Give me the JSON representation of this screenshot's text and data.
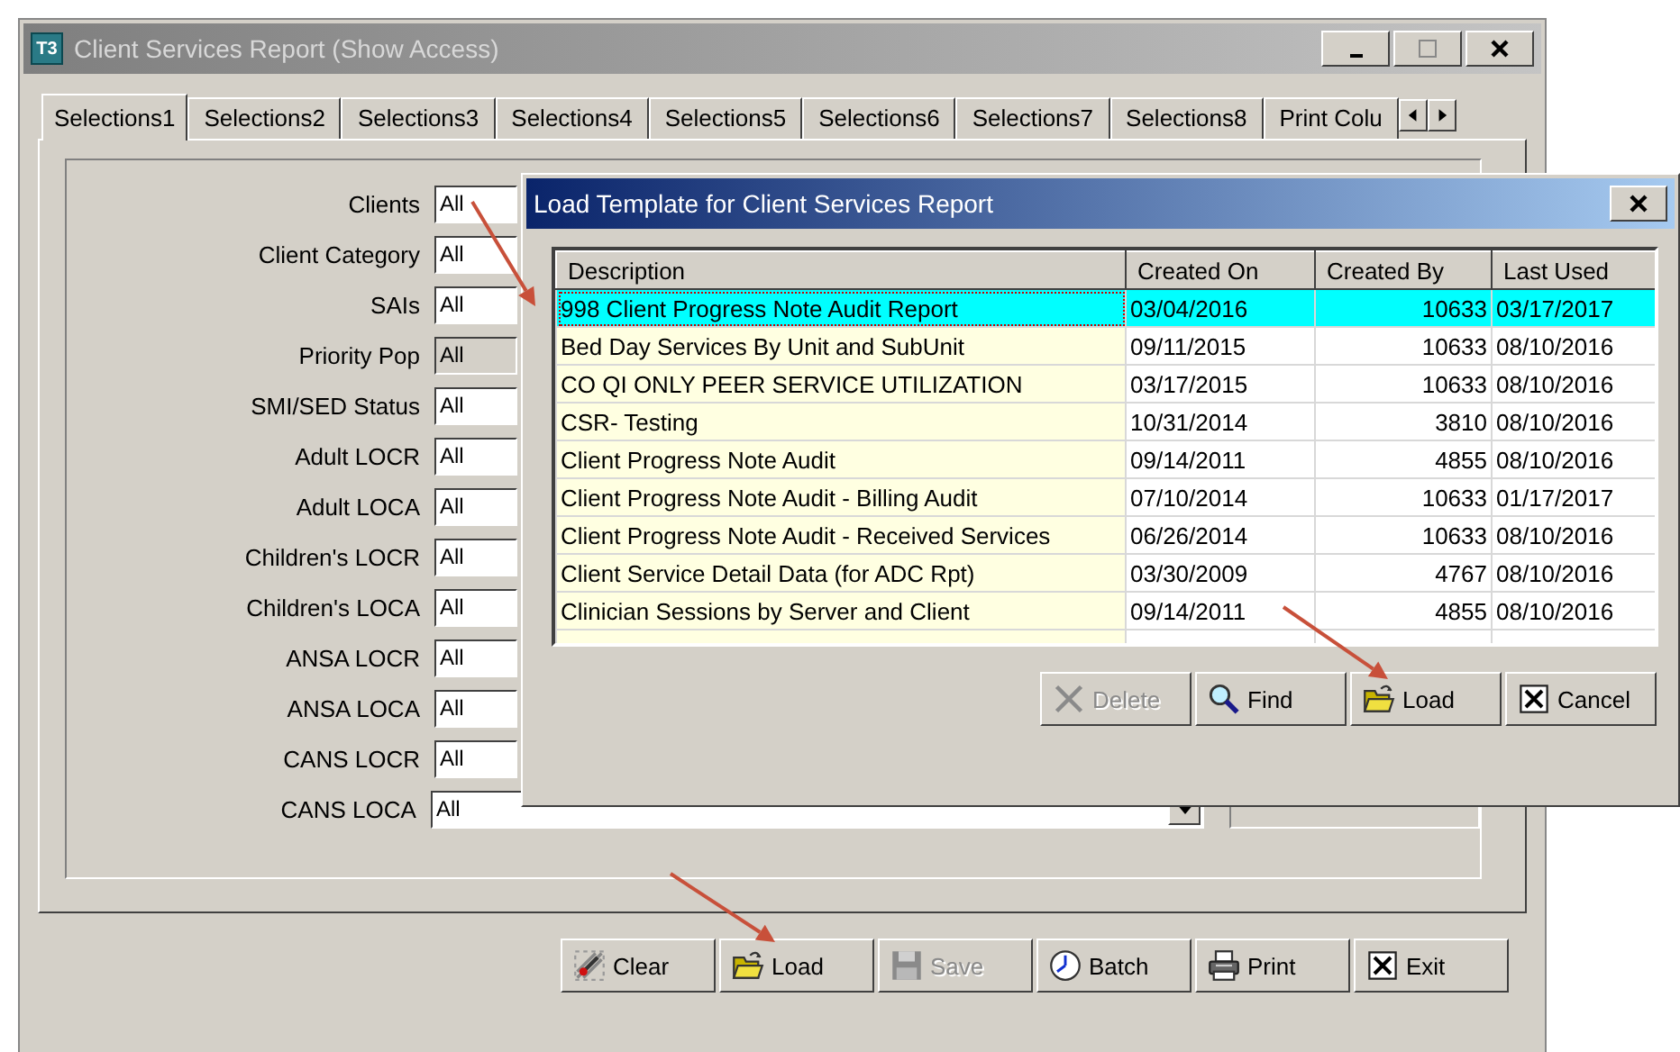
{
  "window": {
    "icon": "T3",
    "title": "Client Services Report (Show Access)"
  },
  "tabs": [
    {
      "label": "Selections1",
      "selected": true
    },
    {
      "label": "Selections2",
      "selected": false
    },
    {
      "label": "Selections3",
      "selected": false
    },
    {
      "label": "Selections4",
      "selected": false
    },
    {
      "label": "Selections5",
      "selected": false
    },
    {
      "label": "Selections6",
      "selected": false
    },
    {
      "label": "Selections7",
      "selected": false
    },
    {
      "label": "Selections8",
      "selected": false
    },
    {
      "label": "Print Colu",
      "selected": false
    }
  ],
  "fields": [
    {
      "label": "Clients",
      "value": "All",
      "disabled": false
    },
    {
      "label": "Client Category",
      "value": "All",
      "disabled": false
    },
    {
      "label": "SAIs",
      "value": "All",
      "disabled": false
    },
    {
      "label": "Priority Pop",
      "value": "All",
      "disabled": true
    },
    {
      "label": "SMI/SED Status",
      "value": "All",
      "disabled": false
    },
    {
      "label": "Adult LOCR",
      "value": "All",
      "disabled": false
    },
    {
      "label": "Adult LOCA",
      "value": "All",
      "disabled": false
    },
    {
      "label": "Children's LOCR",
      "value": "All",
      "disabled": false
    },
    {
      "label": "Children's LOCA",
      "value": "All",
      "disabled": false
    },
    {
      "label": "ANSA LOCR",
      "value": "All",
      "disabled": false
    },
    {
      "label": "ANSA LOCA",
      "value": "All",
      "disabled": false
    },
    {
      "label": "CANS LOCR",
      "value": "All",
      "disabled": false
    },
    {
      "label": "CANS LOCA",
      "value": "All",
      "disabled": false
    }
  ],
  "buttons": [
    {
      "label": "Clear",
      "kind": "clear",
      "disabled": false
    },
    {
      "label": "Load",
      "kind": "load",
      "disabled": false
    },
    {
      "label": "Save",
      "kind": "save",
      "disabled": true
    },
    {
      "label": "Batch",
      "kind": "batch",
      "disabled": false
    },
    {
      "label": "Print",
      "kind": "print",
      "disabled": false
    },
    {
      "label": "Exit",
      "kind": "exit",
      "disabled": false
    }
  ],
  "dialog": {
    "title": "Load Template for Client Services Report",
    "columns": [
      "Description",
      "Created On",
      "Created By",
      "Last Used"
    ],
    "rows": [
      {
        "cells": [
          "998 Client Progress Note Audit Report",
          "03/04/2016",
          "10633",
          "03/17/2017"
        ],
        "selected": true
      },
      {
        "cells": [
          "Bed Day Services By Unit and SubUnit",
          "09/11/2015",
          "10633",
          "08/10/2016"
        ],
        "selected": false
      },
      {
        "cells": [
          "CO QI ONLY PEER SERVICE UTILIZATION",
          "03/17/2015",
          "10633",
          "08/10/2016"
        ],
        "selected": false
      },
      {
        "cells": [
          "CSR- Testing",
          "10/31/2014",
          "3810",
          "08/10/2016"
        ],
        "selected": false
      },
      {
        "cells": [
          "Client Progress Note Audit",
          "09/14/2011",
          "4855",
          "08/10/2016"
        ],
        "selected": false
      },
      {
        "cells": [
          "Client Progress Note Audit - Billing Audit",
          "07/10/2014",
          "10633",
          "01/17/2017"
        ],
        "selected": false
      },
      {
        "cells": [
          "Client Progress Note Audit - Received Services",
          "06/26/2014",
          "10633",
          "08/10/2016"
        ],
        "selected": false
      },
      {
        "cells": [
          "Client Service Detail Data (for ADC Rpt)",
          "03/30/2009",
          "4767",
          "08/10/2016"
        ],
        "selected": false
      },
      {
        "cells": [
          "Clinician Sessions by Server and Client",
          "09/14/2011",
          "4855",
          "08/10/2016"
        ],
        "selected": false
      }
    ],
    "buttons": [
      {
        "label": "Delete",
        "kind": "delete",
        "disabled": true
      },
      {
        "label": "Find",
        "kind": "find",
        "disabled": false
      },
      {
        "label": "Load",
        "kind": "load",
        "disabled": false
      },
      {
        "label": "Cancel",
        "kind": "exit",
        "disabled": false
      }
    ]
  }
}
